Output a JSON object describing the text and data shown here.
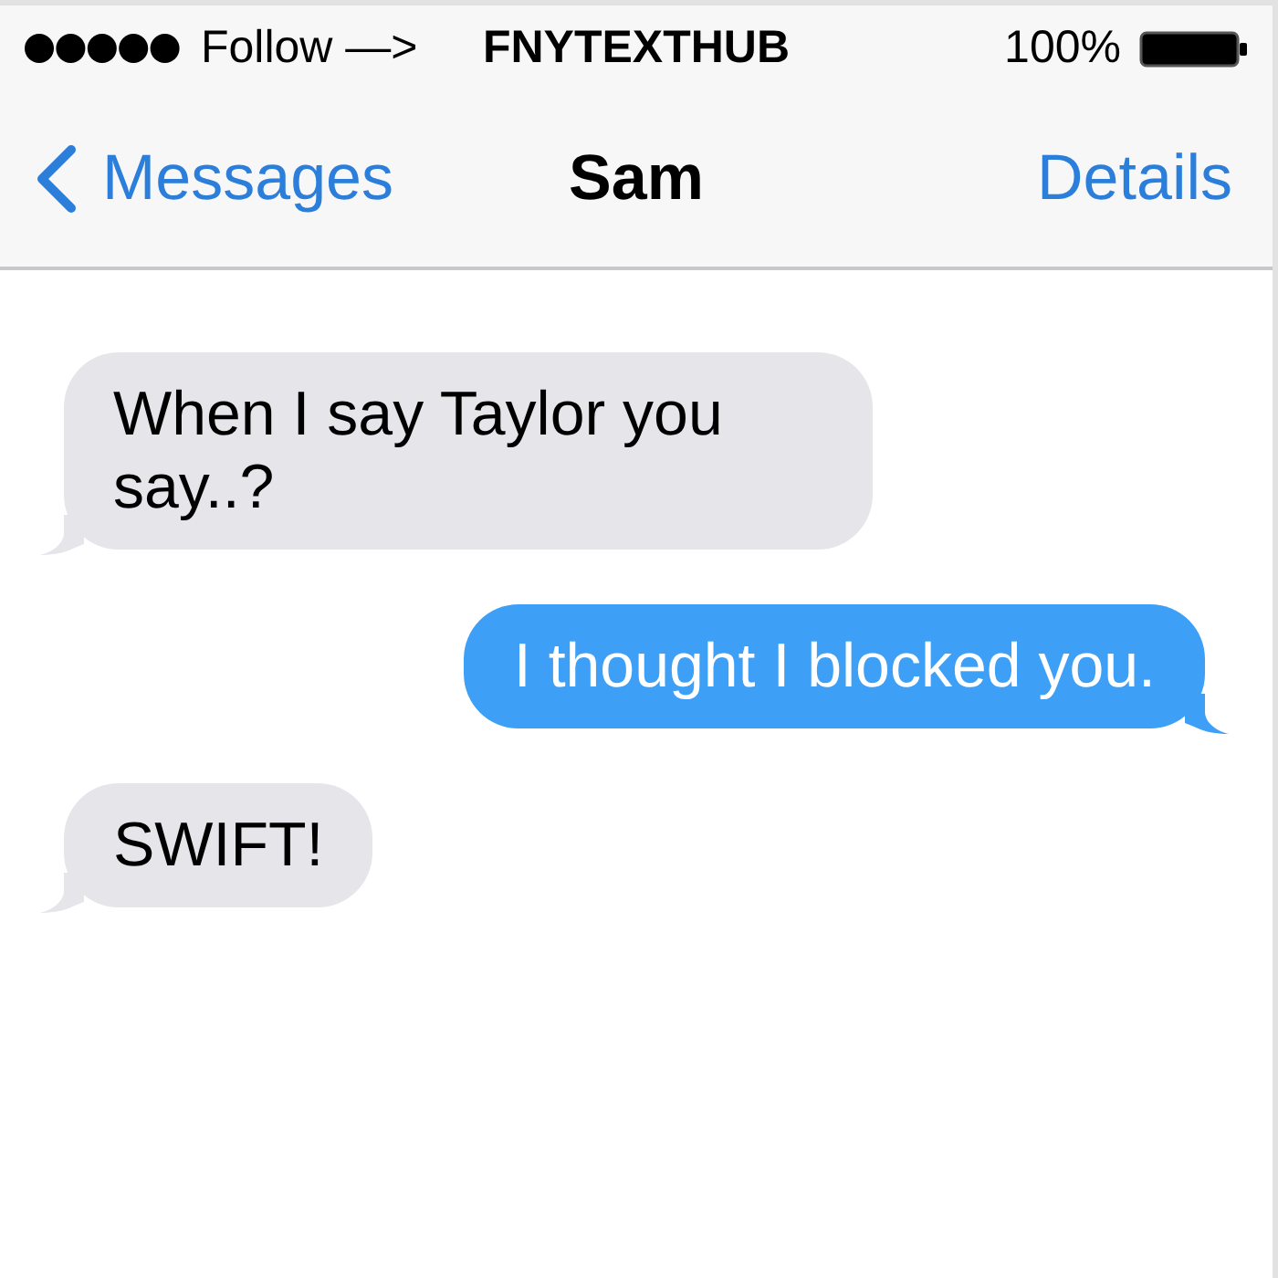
{
  "status_bar": {
    "carrier": "Follow —>",
    "center_text": "FNYTEXTHUB",
    "battery_percent": "100%"
  },
  "nav_bar": {
    "back_label": "Messages",
    "title": "Sam",
    "action": "Details"
  },
  "messages": [
    {
      "kind": "received",
      "text": "When I say Taylor you say..?"
    },
    {
      "kind": "sent",
      "text": "I thought I blocked you."
    },
    {
      "kind": "received",
      "text": "SWIFT!"
    }
  ]
}
